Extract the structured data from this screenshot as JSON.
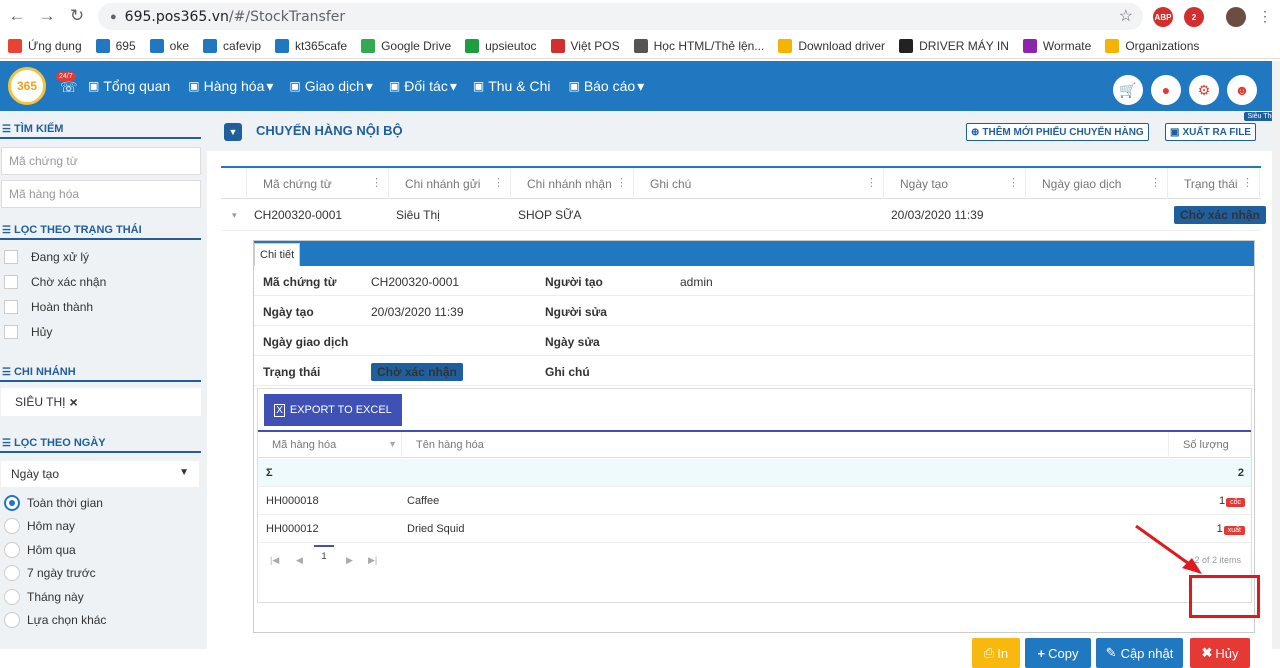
{
  "browser": {
    "url_host": "695.pos365.vn",
    "url_path": "/#/StockTransfer",
    "back_icon": "arrow-left-icon",
    "forward_icon": "arrow-right-icon",
    "reload_icon": "reload-icon",
    "star_icon": "star-icon",
    "ext_abp": "ABP",
    "ext_badge_count": "2"
  },
  "bookmarks": [
    {
      "label": "Ứng dụng",
      "color": "#ea4335"
    },
    {
      "label": "695",
      "color": "#1f78c0"
    },
    {
      "label": "oke",
      "color": "#1f78c0"
    },
    {
      "label": "cafevip",
      "color": "#1f78c0"
    },
    {
      "label": "kt365cafe",
      "color": "#1f78c0"
    },
    {
      "label": "Google Drive",
      "color": "#34a853"
    },
    {
      "label": "upsieutoc",
      "color": "#1b9e3e"
    },
    {
      "label": "Việt POS",
      "color": "#d32f2f"
    },
    {
      "label": "Học HTML/Thẻ lện...",
      "color": "#555555"
    },
    {
      "label": "Download driver",
      "color": "#f4b400"
    },
    {
      "label": "DRIVER MÁY IN",
      "color": "#222222"
    },
    {
      "label": "Wormate",
      "color": "#8e24aa"
    },
    {
      "label": "Organizations",
      "color": "#f4b400"
    }
  ],
  "topbar": {
    "badge": "24/7",
    "menu": [
      {
        "label": "Tổng quan",
        "icon": "dashboard-icon",
        "caret": ""
      },
      {
        "label": "Hàng hóa",
        "icon": "cubes-icon",
        "caret": "▾"
      },
      {
        "label": "Giao dịch",
        "icon": "exchange-icon",
        "caret": "▾"
      },
      {
        "label": "Đối tác",
        "icon": "users-icon",
        "caret": "▾"
      },
      {
        "label": "Thu & Chi",
        "icon": "money-icon",
        "caret": ""
      },
      {
        "label": "Báo cáo",
        "icon": "chart-icon",
        "caret": "▾"
      }
    ]
  },
  "sidebar": {
    "search_title": "TÌM KIẾM",
    "search_doc_placeholder": "Mã chứng từ",
    "search_item_placeholder": "Mã hàng hóa",
    "status_title": "LỌC THEO TRẠNG THÁI",
    "statuses": [
      "Đang xử lý",
      "Chờ xác nhận",
      "Hoàn thành",
      "Hủy"
    ],
    "branch_title": "CHI NHÁNH",
    "branch_tag": "SIÊU THỊ",
    "date_title": "LỌC THEO NGÀY",
    "date_select": "Ngày tạo",
    "date_options": [
      {
        "label": "Toàn thời gian",
        "selected": true
      },
      {
        "label": "Hôm nay",
        "selected": false
      },
      {
        "label": "Hôm qua",
        "selected": false
      },
      {
        "label": "7 ngày trước",
        "selected": false
      },
      {
        "label": "Tháng này",
        "selected": false
      },
      {
        "label": "Lựa chọn khác",
        "selected": false
      }
    ]
  },
  "page": {
    "title": "CHUYỂN HÀNG NỘI BỘ",
    "add_button": "THÊM MỚI PHIẾU CHUYỂN HÀNG",
    "export_button": "XUẤT RA FILE",
    "location_tag": "Siêu Thị"
  },
  "grid": {
    "columns": [
      "Mã chứng từ",
      "Chi nhánh gửi",
      "Chi nhánh nhận",
      "Ghi chú",
      "Ngày tạo",
      "Ngày giao dịch",
      "Trạng thái"
    ],
    "row": {
      "code": "CH200320-0001",
      "from": "Siêu Thị",
      "to": "SHOP SỮA",
      "note": "",
      "created": "20/03/2020 11:39",
      "trans_date": "",
      "status": "Chờ xác nhận"
    }
  },
  "detail": {
    "tab": "Chi tiết",
    "fields": {
      "code_label": "Mã chứng từ",
      "code_value": "CH200320-0001",
      "creator_label": "Người tạo",
      "creator_value": "admin",
      "created_label": "Ngày tạo",
      "created_value": "20/03/2020 11:39",
      "editor_label": "Người sửa",
      "trans_label": "Ngày giao dịch",
      "edited_label": "Ngày sửa",
      "status_label": "Trạng thái",
      "status_value": "Chờ xác nhận",
      "note_label": "Ghi chú"
    },
    "export_excel": "EXPORT TO EXCEL",
    "items_columns": [
      "Mã hàng hóa",
      "Tên hàng hóa",
      "Số lượng"
    ],
    "sum_symbol": "Σ",
    "sum_value": "2",
    "items": [
      {
        "code": "HH000018",
        "name": "Caffee",
        "qty": "1",
        "unit": "cốc"
      },
      {
        "code": "HH000012",
        "name": "Dried Squid",
        "qty": "1",
        "unit": "xuất"
      }
    ],
    "pager_page": "1",
    "pager_info": "2 of 2 items"
  },
  "actions": {
    "print": "In",
    "copy": "Copy",
    "update": "Cập nhật",
    "cancel": "Hủy"
  },
  "colors": {
    "primary": "#1f78c0",
    "dark": "#1f5f9e",
    "print": "#f8b80e",
    "cancel": "#e53935",
    "highlight": "#e0191e"
  }
}
